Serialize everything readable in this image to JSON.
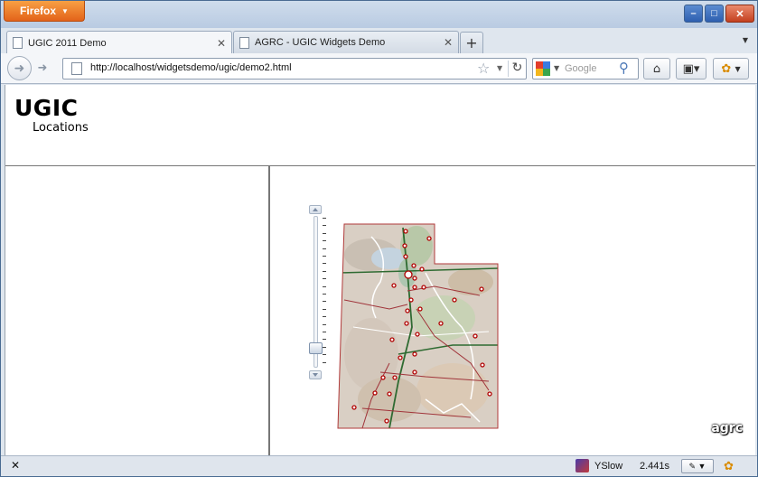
{
  "browser": {
    "menu_button": "Firefox",
    "tabs": [
      {
        "label": "UGIC 2011 Demo",
        "active": true
      },
      {
        "label": "AGRC - UGIC Widgets Demo",
        "active": false
      }
    ],
    "new_tab": "+",
    "url": "http://localhost/widgetsdemo/ugic/demo2.html",
    "search_placeholder": "Google",
    "window_controls": {
      "minimize": "–",
      "maximize": "□",
      "close": "✕"
    }
  },
  "page": {
    "title": "UGIC",
    "subtitle": "Locations",
    "map_logo": "agrc"
  },
  "status": {
    "close": "✕",
    "yslow": "YSlow",
    "load_time": "2.441s"
  },
  "colors": {
    "firefox_orange": "#e8741f",
    "map_border": "#b03a3a",
    "map_marker": "#b00000"
  },
  "icons": [
    "page-icon",
    "back-icon",
    "forward-icon",
    "star-icon",
    "reload-icon",
    "google-icon",
    "search-icon",
    "home-icon",
    "bookmarks-icon",
    "firebug-icon",
    "yslow-icon",
    "zoom-in-icon",
    "zoom-out-icon"
  ]
}
